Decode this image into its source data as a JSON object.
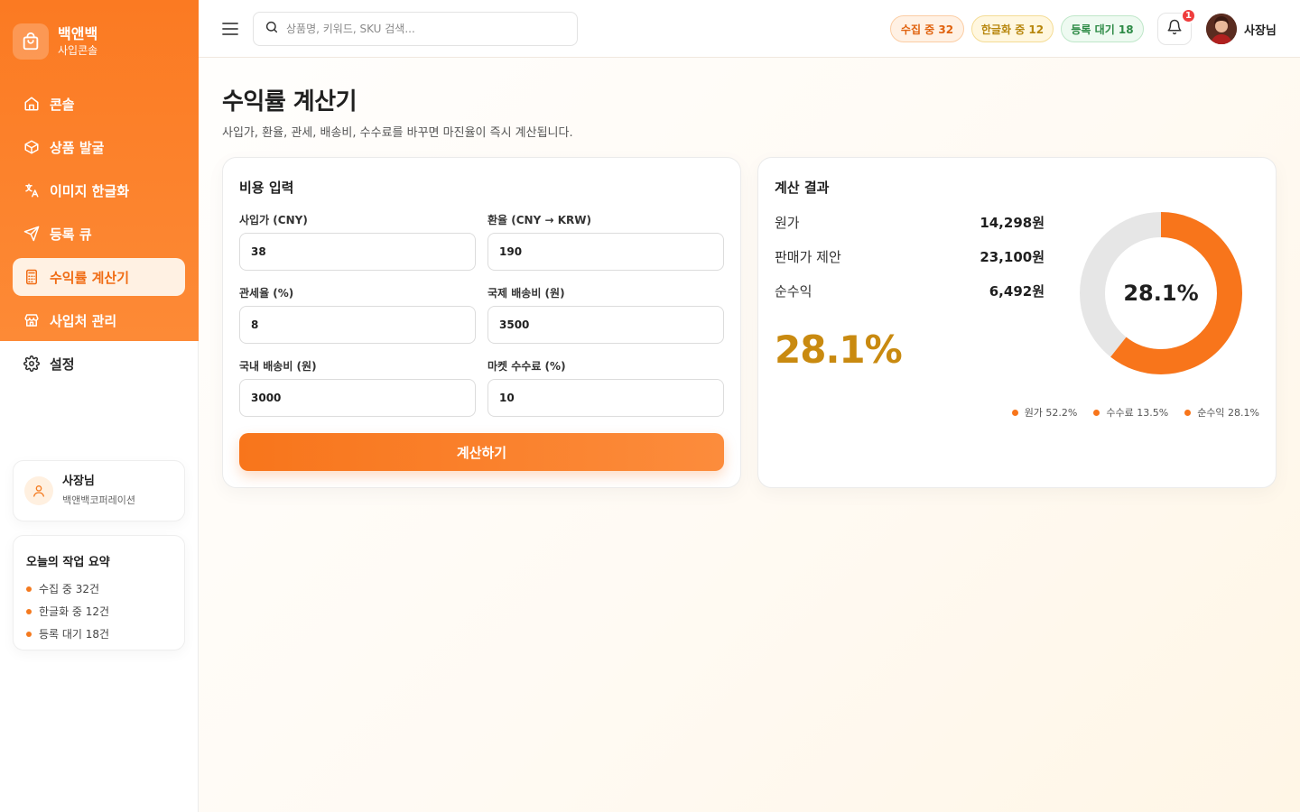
{
  "brand": {
    "name": "백앤백",
    "subtitle": "사입콘솔"
  },
  "nav": [
    {
      "label": "콘솔",
      "icon": "home-icon"
    },
    {
      "label": "상품 발굴",
      "icon": "box-icon"
    },
    {
      "label": "이미지 한글화",
      "icon": "translate-icon"
    },
    {
      "label": "등록 큐",
      "icon": "send-icon"
    },
    {
      "label": "수익률 계산기",
      "icon": "calculator-icon",
      "active": true
    },
    {
      "label": "사입처 관리",
      "icon": "store-icon"
    },
    {
      "label": "설정",
      "icon": "gear-icon"
    }
  ],
  "profile": {
    "name": "사장님",
    "org": "백앤백코퍼레이션"
  },
  "summary": {
    "title": "오늘의 작업 요약",
    "items": [
      "수집 중 32건",
      "한글화 중 12건",
      "등록 대기 18건"
    ]
  },
  "topbar": {
    "search_placeholder": "상품명, 키워드, SKU 검색...",
    "pills": [
      "수집 중 32",
      "한글화 중 12",
      "등록 대기 18"
    ],
    "notification_count": "1",
    "user_name": "사장님"
  },
  "page": {
    "title": "수익률 계산기",
    "description": "사입가, 환율, 관세, 배송비, 수수료를 바꾸면 마진율이 즉시 계산됩니다."
  },
  "input_card": {
    "title": "비용 입력",
    "fields": [
      {
        "label": "사입가 (CNY)",
        "value": "38"
      },
      {
        "label": "환율 (CNY → KRW)",
        "value": "190"
      },
      {
        "label": "관세율 (%)",
        "value": "8"
      },
      {
        "label": "국제 배송비 (원)",
        "value": "3500"
      },
      {
        "label": "국내 배송비 (원)",
        "value": "3000"
      },
      {
        "label": "마켓 수수료 (%)",
        "value": "10"
      }
    ],
    "button_label": "계산하기"
  },
  "result_card": {
    "title": "계산 결과",
    "rows": [
      {
        "label": "원가",
        "value": "14,298원"
      },
      {
        "label": "판매가 제안",
        "value": "23,100원"
      },
      {
        "label": "순수익",
        "value": "6,492원"
      }
    ],
    "margin_big": "28.1%",
    "donut_center": "28.1%"
  },
  "chart_data": {
    "type": "pie",
    "categories": [
      "원가",
      "수수료",
      "순수익"
    ],
    "values": [
      52.2,
      13.5,
      28.1
    ],
    "legend": [
      "원가 52.2%",
      "수수료 13.5%",
      "순수익 28.1%"
    ],
    "highlight_value": 28.1
  },
  "colors": {
    "accent": "#f8751b",
    "accent_light": "#fff1e3",
    "donut_fill": "#f8751b",
    "donut_track": "#e6e6e6",
    "margin_text": "#c98a10"
  }
}
